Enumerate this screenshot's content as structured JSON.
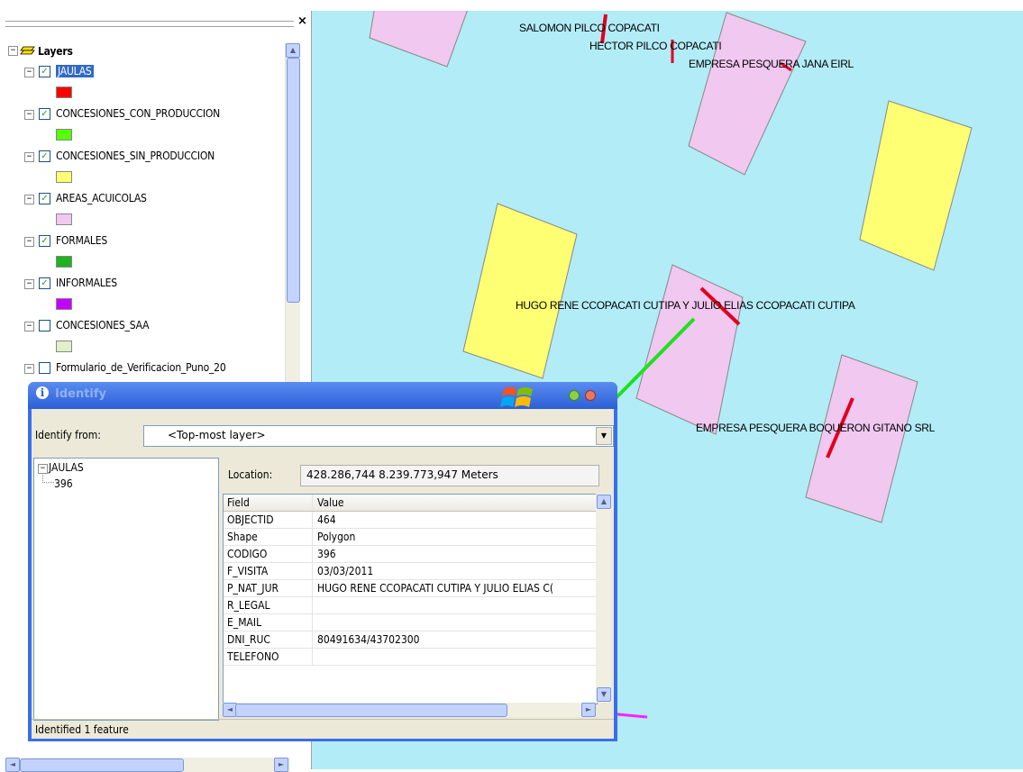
{
  "toc": {
    "close_label": "×",
    "root_label": "Layers",
    "layers": [
      {
        "name": "JAULAS",
        "checked": true,
        "color": "#ff0000",
        "selected": true
      },
      {
        "name": "CONCESIONES_CON_PRODUCCION",
        "checked": true,
        "color": "#55ff00"
      },
      {
        "name": "CONCESIONES_SIN_PRODUCCION",
        "checked": true,
        "color": "#ffff73"
      },
      {
        "name": "AREAS_ACUICOLAS",
        "checked": true,
        "color": "#f0c8f0"
      },
      {
        "name": "FORMALES",
        "checked": true,
        "color": "#1fb31f"
      },
      {
        "name": "INFORMALES",
        "checked": true,
        "color": "#c500ff"
      },
      {
        "name": "CONCESIONES_SAA",
        "checked": false,
        "color": "#e0f0c8"
      },
      {
        "name": "Formulario_de_Verificacion_Puno_20",
        "checked": false,
        "color": null
      }
    ]
  },
  "map": {
    "labels": {
      "salomon": "SALOMON PILCO COPACATI",
      "hector": "HECTOR PILCO COPACATI",
      "janaeirl": "EMPRESA PESQUERA JANA EIRL",
      "hugo": "HUGO RENE CCOPACATI CUTIPA Y JULIO ELIAS CCOPACATI CUTIPA",
      "boqueron": "EMPRESA PESQUERA BOQUERON GITANO SRL"
    },
    "colors": {
      "water": "#b2ecf7",
      "area": "#f0c8f0",
      "concession": "#ffff73",
      "cage": "#e0001e",
      "green_arrow": "#20e020",
      "magenta_arrow": "#ff20ff"
    }
  },
  "identify": {
    "title": "Identify",
    "from_label": "Identify from:",
    "from_value": "<Top-most layer>",
    "tree_layer": "JAULAS",
    "tree_feature": "396",
    "location_label": "Location:",
    "location_value": "428.286,744  8.239.773,947 Meters",
    "col_field": "Field",
    "col_value": "Value",
    "rows": [
      {
        "field": "OBJECTID",
        "value": "464"
      },
      {
        "field": "Shape",
        "value": "Polygon"
      },
      {
        "field": "CODIGO",
        "value": "396"
      },
      {
        "field": "F_VISITA",
        "value": "03/03/2011"
      },
      {
        "field": "P_NAT_JUR",
        "value": "HUGO RENE CCOPACATI CUTIPA Y JULIO ELIAS C("
      },
      {
        "field": "R_LEGAL",
        "value": ""
      },
      {
        "field": "E_MAIL",
        "value": ""
      },
      {
        "field": "DNI_RUC",
        "value": "80491634/43702300"
      },
      {
        "field": "TELEFONO",
        "value": ""
      }
    ],
    "status": "Identified 1 feature"
  }
}
